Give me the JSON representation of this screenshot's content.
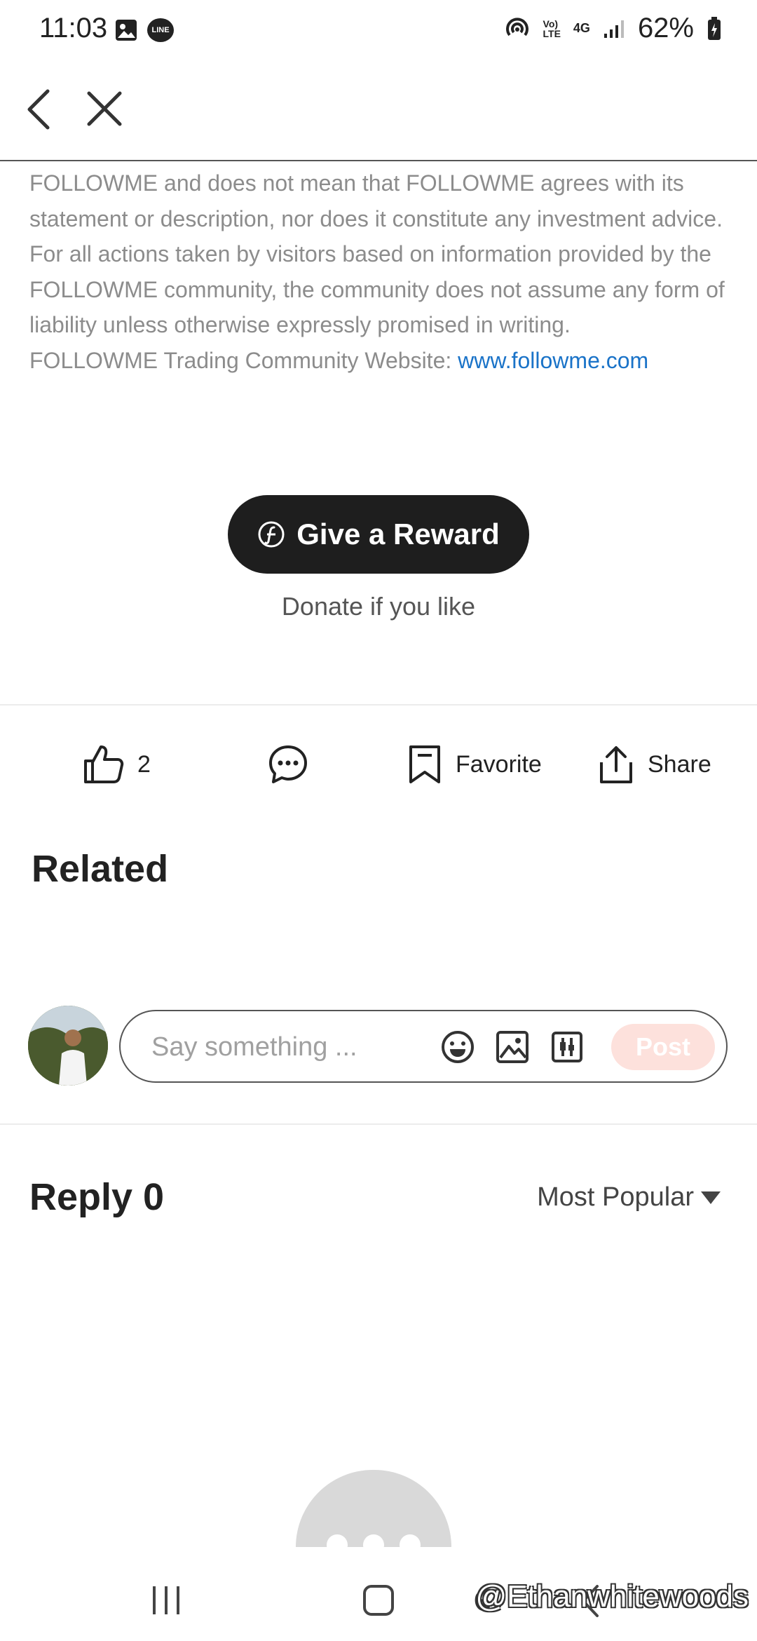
{
  "status_bar": {
    "time": "11:03",
    "battery": "62%",
    "line_badge": "LINE",
    "net_label_1": "Vo)\nLTE",
    "net_label_2": "4G"
  },
  "nav": {
    "back_icon": "chevron-left-icon",
    "close_icon": "close-icon"
  },
  "article": {
    "disclaimer_text": "FOLLOWME and does not mean that FOLLOWME agrees with its statement or description, nor does it constitute any investment advice. For all actions taken by visitors based on information provided by the FOLLOWME community, the community does not assume any form of liability unless otherwise expressly promised in writing.",
    "website_label": "FOLLOWME Trading Community Website: ",
    "website_link": "www.followme.com"
  },
  "reward": {
    "button_label": "Give a Reward",
    "subtext": "Donate if you like"
  },
  "actions": {
    "like_count": "2",
    "favorite_label": "Favorite",
    "share_label": "Share"
  },
  "related": {
    "title": "Related"
  },
  "comment": {
    "placeholder": "Say something ...",
    "post_label": "Post"
  },
  "replies": {
    "title": "Reply 0",
    "sort_label": "Most Popular"
  },
  "watermark": "@Ethanwhitewoods",
  "colors": {
    "link": "#1a73c8",
    "reward_bg": "#1e1e1e",
    "post_disabled": "#fde1dc",
    "muted_text": "#8c8c8c"
  }
}
